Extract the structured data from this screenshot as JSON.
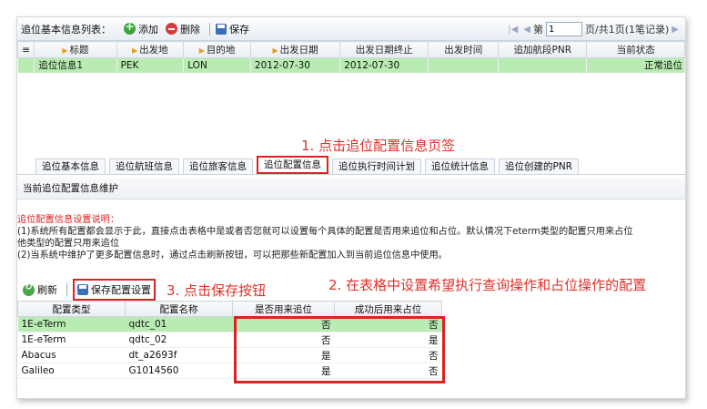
{
  "toolbar": {
    "title": "追位基本信息列表：",
    "add": "添加",
    "delete": "删除",
    "save": "保存"
  },
  "pager": {
    "page_prefix": "第",
    "page_value": "1",
    "page_suffix": "页/共1页(1笔记录)"
  },
  "main_grid": {
    "columns": [
      "标题",
      "出发地",
      "目的地",
      "出发日期",
      "出发日期终止",
      "出发时间",
      "追加航段PNR",
      "当前状态"
    ],
    "rows": [
      {
        "title": "追位信息1",
        "origin": "PEK",
        "dest": "LON",
        "date": "2012-07-30",
        "date_end": "2012-07-30",
        "time": "",
        "pnr": "",
        "status": "正常追位"
      }
    ]
  },
  "annotations": {
    "step1": "1. 点击追位配置信息页签",
    "step2": "2. 在表格中设置希望执行查询操作和占位操作的配置",
    "step3": "3. 点击保存按钮"
  },
  "tabs": [
    "追位基本信息",
    "追位航班信息",
    "追位旅客信息",
    "追位配置信息",
    "追位执行时间计划",
    "追位统计信息",
    "追位创建的PNR"
  ],
  "section_title": "当前追位配置信息维护",
  "note": {
    "head": "追位配置信息设置说明：",
    "line1": "(1)系统所有配置都会显示于此，直接点击表格中是或者否您就可以设置每个具体的配置是否用来追位和占位。默认情况下eterm类型的配置只用来占位",
    "line2": "他类型的配置只用来追位",
    "line3": "(2)当系统中维护了更多配置信息时，通过点击刷新按钮，可以把那些新配置加入到当前追位信息中使用。"
  },
  "toolbar2": {
    "refresh": "刷新",
    "save_config": "保存配置设置"
  },
  "config_grid": {
    "columns": [
      "配置类型",
      "配置名称",
      "是否用来追位",
      "成功后用来占位"
    ],
    "rows": [
      {
        "type": "1E-eTerm",
        "name": "qdtc_01",
        "track": "否",
        "hold": "否"
      },
      {
        "type": "1E-eTerm",
        "name": "qdtc_02",
        "track": "否",
        "hold": "是"
      },
      {
        "type": "Abacus",
        "name": "dt_a2693f",
        "track": "是",
        "hold": "否"
      },
      {
        "type": "Galileo",
        "name": "G1014560",
        "track": "是",
        "hold": "否"
      }
    ]
  }
}
